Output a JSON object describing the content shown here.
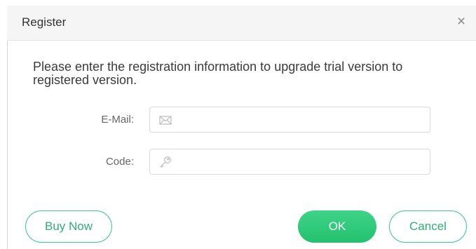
{
  "dialog": {
    "title": "Register",
    "close_glyph": "×",
    "message": "Please enter the registration information to upgrade trial version to registered version."
  },
  "form": {
    "email": {
      "label": "E-Mail:",
      "value": "",
      "placeholder": "",
      "icon": "envelope-icon"
    },
    "code": {
      "label": "Code:",
      "value": "",
      "placeholder": "",
      "icon": "key-icon"
    }
  },
  "buttons": {
    "buy_now": "Buy Now",
    "ok": "OK",
    "cancel": "Cancel"
  },
  "colors": {
    "accent": "#2ecc71",
    "accent_text": "#2fae76",
    "title_bar": "#f5f5f5"
  }
}
